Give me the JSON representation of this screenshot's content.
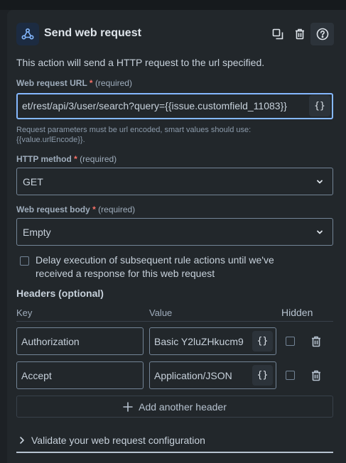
{
  "header": {
    "title": "Send web request",
    "icon": "webhook-icon",
    "actions": [
      "copy-icon",
      "trash-icon",
      "help-icon"
    ]
  },
  "description": "This action will send a HTTP request to the url specified.",
  "url": {
    "label": "Web request URL",
    "required_mark": "*",
    "required_text": "(required)",
    "value": "et/rest/api/3/user/search?query={{issue.customfield_11083}}",
    "smart_value_button": "{}",
    "helper_line1": "Request parameters must be url encoded, smart values should use:",
    "helper_line2": "{{value.urlEncode}}."
  },
  "method": {
    "label": "HTTP method",
    "required_mark": "*",
    "required_text": "(required)",
    "value": "GET"
  },
  "body": {
    "label": "Web request body",
    "required_mark": "*",
    "required_text": "(required)",
    "value": "Empty"
  },
  "delay": {
    "checked": false,
    "label_line1": "Delay execution of subsequent rule actions until we've",
    "label_line2": "received a response for this web request"
  },
  "headers": {
    "title": "Headers (optional)",
    "col_key": "Key",
    "col_value": "Value",
    "col_hidden": "Hidden",
    "rows": [
      {
        "key": "Authorization",
        "value": "Basic Y2luZHkucm9",
        "brace": "{}",
        "hidden": false
      },
      {
        "key": "Accept",
        "value": "Application/JSON",
        "brace": "{}",
        "hidden": false
      }
    ],
    "add_label": "Add another header"
  },
  "validate": {
    "label": "Validate your web request configuration"
  },
  "colors": {
    "accent": "#85b8ff",
    "required": "#f87168",
    "background": "#22272b"
  }
}
